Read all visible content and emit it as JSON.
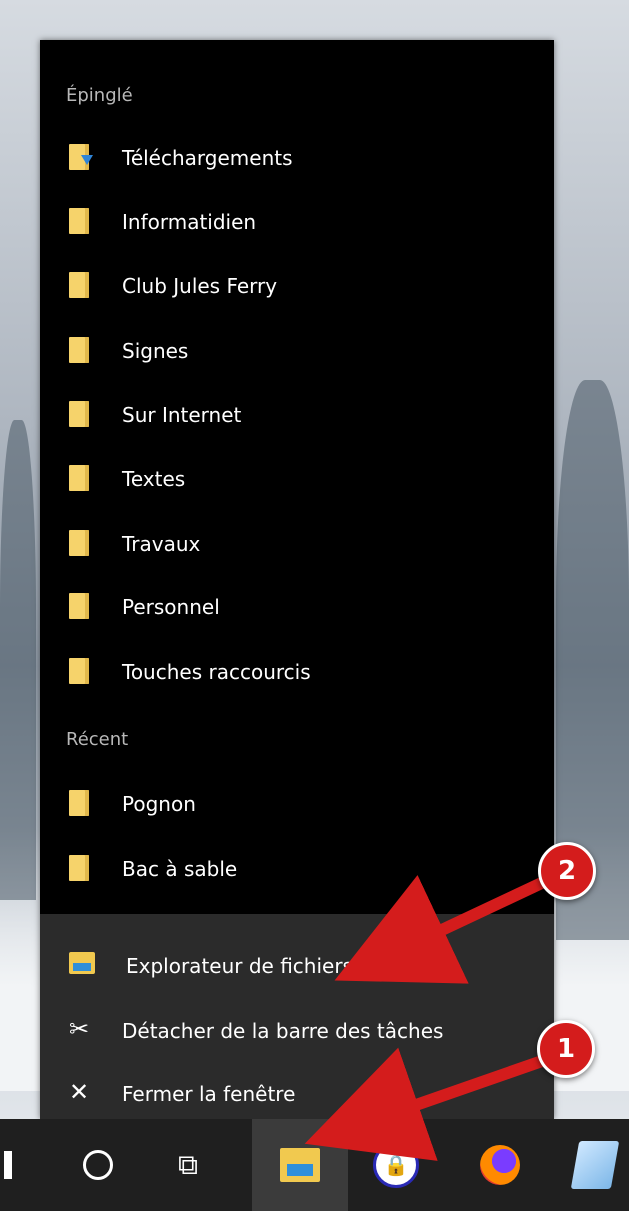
{
  "pinned": {
    "title": "Épinglé",
    "items": [
      {
        "label": "Téléchargements",
        "icon": "downloads-folder-icon"
      },
      {
        "label": "Informatidien",
        "icon": "folder-icon"
      },
      {
        "label": "Club Jules Ferry",
        "icon": "folder-icon"
      },
      {
        "label": "Signes",
        "icon": "folder-icon"
      },
      {
        "label": "Sur Internet",
        "icon": "folder-icon"
      },
      {
        "label": "Textes",
        "icon": "folder-icon"
      },
      {
        "label": "Travaux",
        "icon": "folder-icon"
      },
      {
        "label": "Personnel",
        "icon": "folder-icon"
      },
      {
        "label": "Touches raccourcis",
        "icon": "folder-icon"
      }
    ]
  },
  "recent": {
    "title": "Récent",
    "items": [
      {
        "label": "Pognon",
        "icon": "folder-icon"
      },
      {
        "label": "Bac à sable",
        "icon": "folder-icon"
      }
    ]
  },
  "tasks": {
    "explorer": "Explorateur de fichiers",
    "unpin": "Détacher de la barre des tâches",
    "close": "Fermer la fenêtre"
  },
  "annotations": {
    "badge1": "1",
    "badge2": "2",
    "color": "#d41c1c"
  },
  "colors": {
    "menu_bg": "#000000",
    "tasks_bg": "#2b2b2b",
    "folder": "#f6d36b",
    "taskbar": "#1f1f1f"
  }
}
